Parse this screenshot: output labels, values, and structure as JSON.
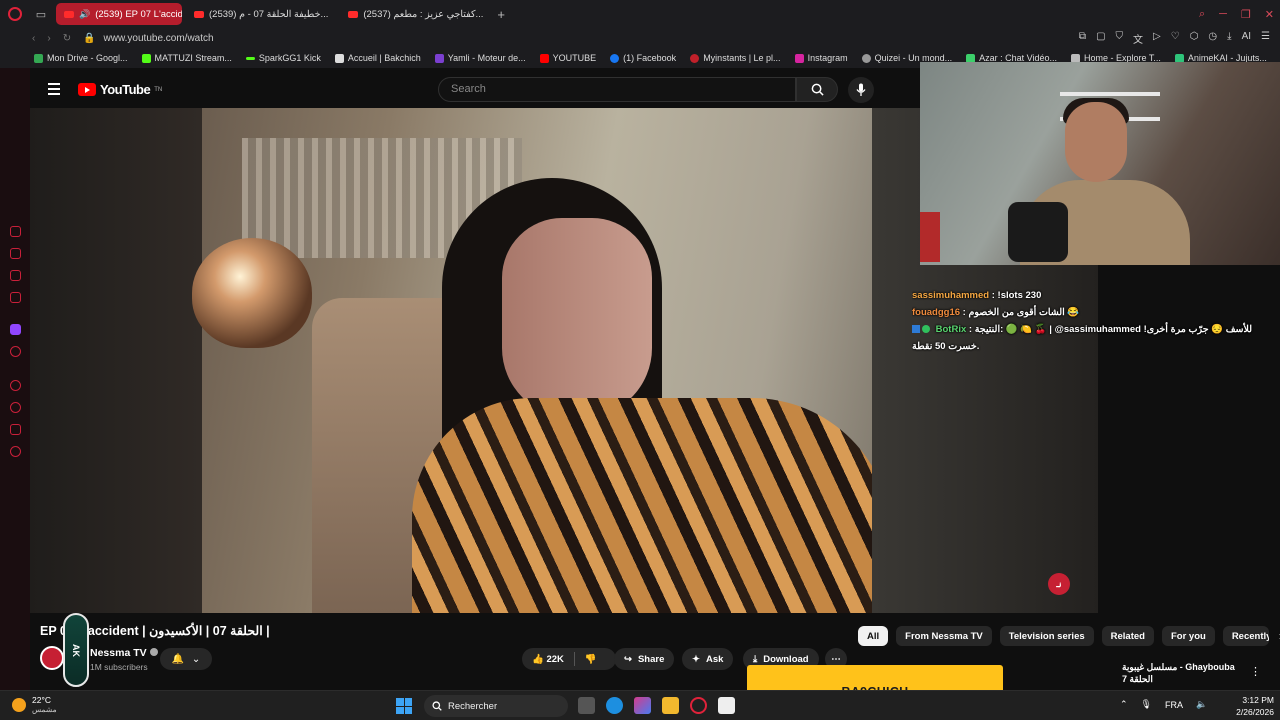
{
  "browser": {
    "tabs": [
      {
        "label": "(2539) EP 07 L'accident",
        "active": true
      },
      {
        "label": "(2539) خطيفة الحلقة 07 - م..."
      },
      {
        "label": "(2537) كفتاجي عزيز : مطعم..."
      }
    ],
    "url": "www.youtube.com/watch",
    "bookmarks": [
      "Mon Drive - Googl...",
      "MATTUZI Stream...",
      "SparkGG1 Kick",
      "Accueil | Bakchich",
      "Yamli - Moteur de...",
      "YOUTUBE",
      "(1) Facebook",
      "Myinstants | Le pl...",
      "Instagram",
      "Quizei - Un mond...",
      "Azar : Chat Vidéo...",
      "Home - Explore T...",
      "AnimeKAI - Jujuts..."
    ],
    "ai_label": "AI"
  },
  "youtube": {
    "logo_text": "YouTube",
    "logo_sup": "TN",
    "search_placeholder": "Search",
    "video_title": "EP 07 L'accident | الحلقة 07 | الأكسيدون |",
    "channel_name": "Nessma TV",
    "subscribers": "1M subscribers",
    "likes": "22K",
    "share_label": "Share",
    "ask_label": "Ask",
    "download_label": "Download",
    "chips": [
      "All",
      "From Nessma TV",
      "Television series",
      "Related",
      "For you",
      "Recently uploaded"
    ],
    "recommended_title": "مسلسل غيبوبة - Ghaybouba الحلقة 7",
    "watermark": "نـ"
  },
  "overlay": {
    "streamer_badge": "AK",
    "chat": [
      {
        "user": "sassimuhammed",
        "text": ": !slots 230"
      },
      {
        "user": "fouadgg16",
        "text": ": الشات أقوى من الخصوم 😂"
      },
      {
        "user": "BotRix",
        "text": ": النتيجة: 🟢 🍋 🍒 | @sassimuhammed للأسف 😔 جرّب مرة أخرى! خسرت 50 نقطة."
      }
    ],
    "bakchich_label": "BA9CHICH",
    "bakchich_progress": 0.03
  },
  "taskbar": {
    "temperature": "22°C",
    "weather_desc": "مشمس",
    "search_label": "Rechercher",
    "language": "FRA",
    "time": "3:12 PM",
    "date": "2/26/2026"
  }
}
